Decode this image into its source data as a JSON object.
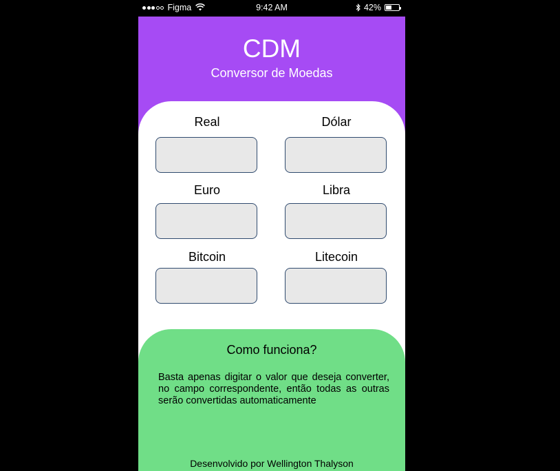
{
  "status_bar": {
    "carrier": "Figma",
    "signal_bars_filled": 3,
    "signal_bars_total": 5,
    "time": "9:42 AM",
    "battery_percent_label": "42%",
    "battery_level": 0.42
  },
  "header": {
    "title": "CDM",
    "subtitle": "Conversor de Moedas",
    "background_color": "#a64bf4"
  },
  "converter": {
    "fields": [
      {
        "label": "Real",
        "value": ""
      },
      {
        "label": "Dólar",
        "value": ""
      },
      {
        "label": "Euro",
        "value": ""
      },
      {
        "label": "Libra",
        "value": ""
      },
      {
        "label": "Bitcoin",
        "value": ""
      },
      {
        "label": "Litecoin",
        "value": ""
      }
    ]
  },
  "info": {
    "title": "Como funciona?",
    "text": "Basta apenas digitar o valor que deseja converter, no campo correspondente, então todas as outras serão convertidas automaticamente",
    "credit": "Desenvolvido por Wellington Thalyson",
    "background_color": "#70de87"
  },
  "icons": {
    "wifi": "wifi-icon",
    "bluetooth": "bluetooth-icon",
    "battery": "battery-icon"
  }
}
